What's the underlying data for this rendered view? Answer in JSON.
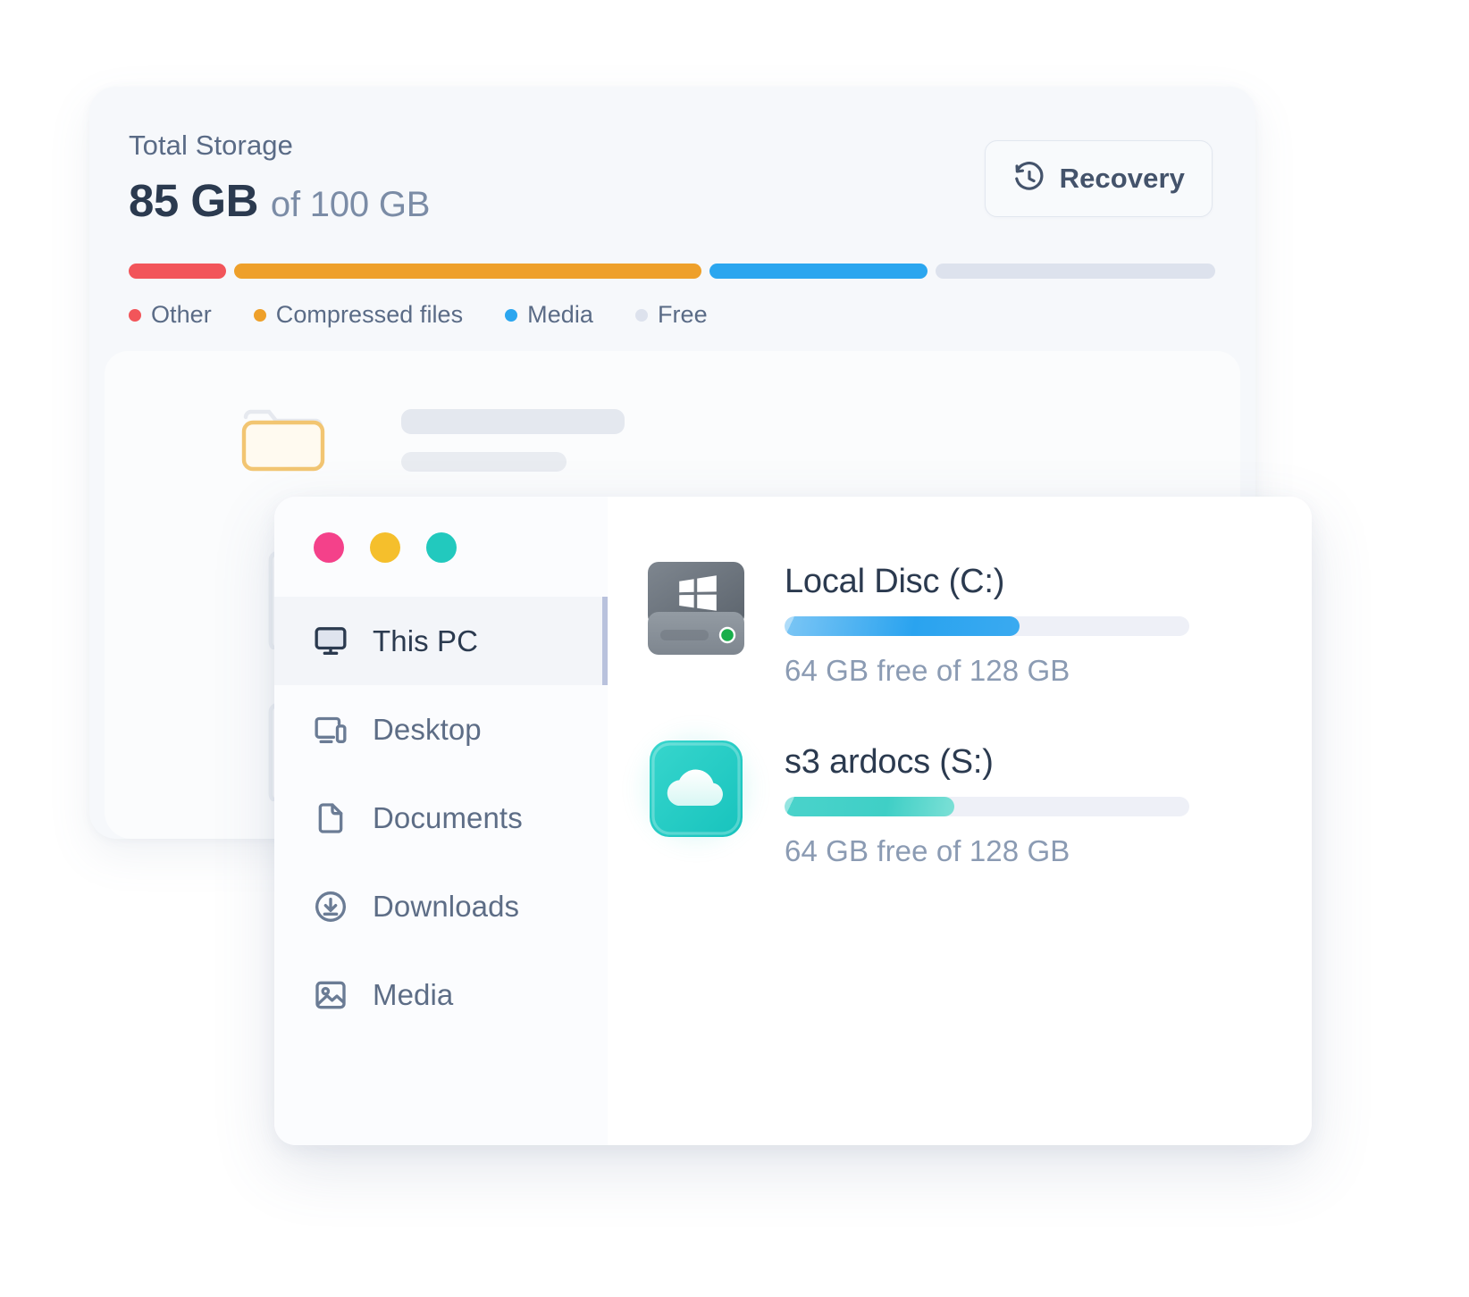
{
  "storage": {
    "title": "Total Storage",
    "used": "85 GB",
    "of_total": "of 100 GB",
    "recovery_label": "Recovery",
    "recovery_icon": "history-clock-icon",
    "segments": [
      {
        "name": "Other",
        "color": "#f2555a",
        "percent": 9
      },
      {
        "name": "Compressed files",
        "color": "#eea02a",
        "percent": 43
      },
      {
        "name": "Media",
        "color": "#2ba6ef",
        "percent": 20
      },
      {
        "name": "Free",
        "color": "#dde2ed",
        "percent": 26
      }
    ],
    "legend": [
      {
        "label": "Other",
        "color": "#f2555a"
      },
      {
        "label": "Compressed files",
        "color": "#eea02a"
      },
      {
        "label": "Media",
        "color": "#2ba6ef"
      },
      {
        "label": "Free",
        "color": "#dde2ed"
      }
    ]
  },
  "skeleton": {
    "folder_icon": "folder-icon",
    "document_icon": "document-icon",
    "document_graph_icon": "document-graph-icon"
  },
  "browser": {
    "window_controls": [
      {
        "name": "close-button",
        "color": "#f4418a"
      },
      {
        "name": "minimize-button",
        "color": "#f5bf2c"
      },
      {
        "name": "maximize-button",
        "color": "#22c9be"
      }
    ],
    "sidebar": {
      "items": [
        {
          "label": "This PC",
          "icon": "monitor-icon",
          "active": true
        },
        {
          "label": "Desktop",
          "icon": "devices-icon",
          "active": false
        },
        {
          "label": "Documents",
          "icon": "document-icon",
          "active": false
        },
        {
          "label": "Downloads",
          "icon": "download-icon",
          "active": false
        },
        {
          "label": "Media",
          "icon": "image-icon",
          "active": false
        }
      ]
    },
    "drives": [
      {
        "name": "Local Disc (C:)",
        "icon": "windows-drive-icon",
        "usage_text": "64 GB free of 128 GB",
        "used_percent": 58,
        "bar_color": "#2aa3ef"
      },
      {
        "name": "s3 ardocs (S:)",
        "icon": "cloud-drive-icon",
        "usage_text": "64 GB free of 128 GB",
        "used_percent": 42,
        "bar_color": "#3fcfc6"
      }
    ]
  }
}
